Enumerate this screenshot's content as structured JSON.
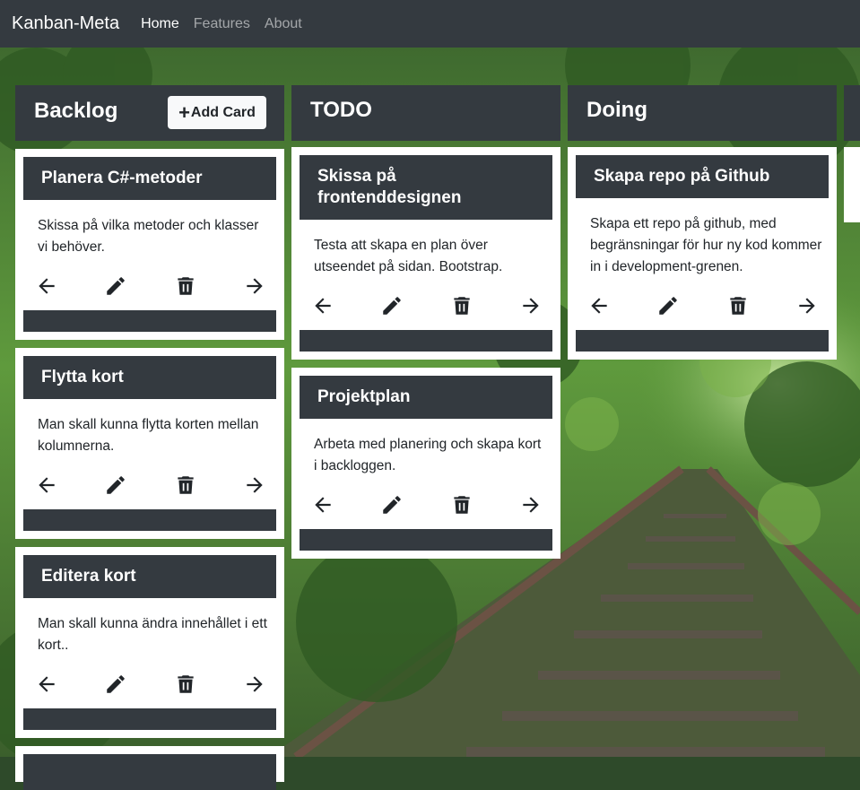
{
  "navbar": {
    "brand": "Kanban-Meta",
    "links": [
      {
        "label": "Home",
        "active": true
      },
      {
        "label": "Features",
        "active": false
      },
      {
        "label": "About",
        "active": false
      }
    ]
  },
  "board": {
    "add_card_label": "Add Card",
    "columns": [
      {
        "title": "Backlog",
        "cards": [
          {
            "title": "Planera C#-metoder",
            "text": "Skissa på vilka metoder och klasser vi behöver."
          },
          {
            "title": "Flytta kort",
            "text": "Man skall kunna flytta korten mellan kolumnerna."
          },
          {
            "title": "Editera kort",
            "text": "Man skall kunna ändra innehållet i ett kort.."
          }
        ]
      },
      {
        "title": "TODO",
        "cards": [
          {
            "title": "Skissa på frontenddesignen",
            "text": "Testa att skapa en plan över utseendet på sidan. Bootstrap."
          },
          {
            "title": "Projektplan",
            "text": "Arbeta med planering och skapa kort i backloggen."
          }
        ]
      },
      {
        "title": "Doing",
        "cards": [
          {
            "title": "Skapa repo på Github",
            "text": "Skapa ett repo på github, med begränsningar för hur ny kod kommer in i development-grenen."
          }
        ]
      }
    ]
  },
  "icons": {
    "move_left": "arrow-left-icon",
    "edit": "pencil-icon",
    "delete": "trash-icon",
    "move_right": "arrow-right-icon"
  },
  "colors": {
    "dark": "#343a40",
    "light_button": "#f8f9fa",
    "card_bg": "#ffffff"
  }
}
